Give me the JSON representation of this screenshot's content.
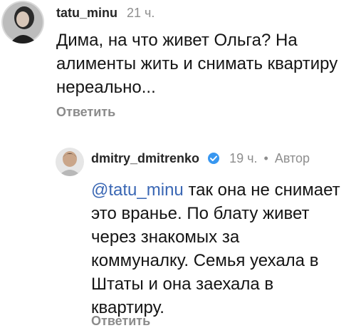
{
  "comments": [
    {
      "username": "tatu_minu",
      "time": "21 ч.",
      "text": "Дима, на что живет Ольга? На алименты жить и снимать квартиру нереально...",
      "reply_label": "Ответить"
    },
    {
      "username": "dmitry_dmitrenko",
      "verified": true,
      "time": "19 ч.",
      "separator": "•",
      "author_label": "Автор",
      "mention": "@tatu_minu",
      "text": "так она не снимает это вранье. По блату живет через знакомых за коммуналку. Семья уехала в Штаты и она заехала в квартиру.",
      "reply_label": "Ответить"
    }
  ],
  "colors": {
    "mention": "#3a67b4",
    "verified_badge": "#3897f0",
    "muted_text": "#8e8e8e"
  }
}
